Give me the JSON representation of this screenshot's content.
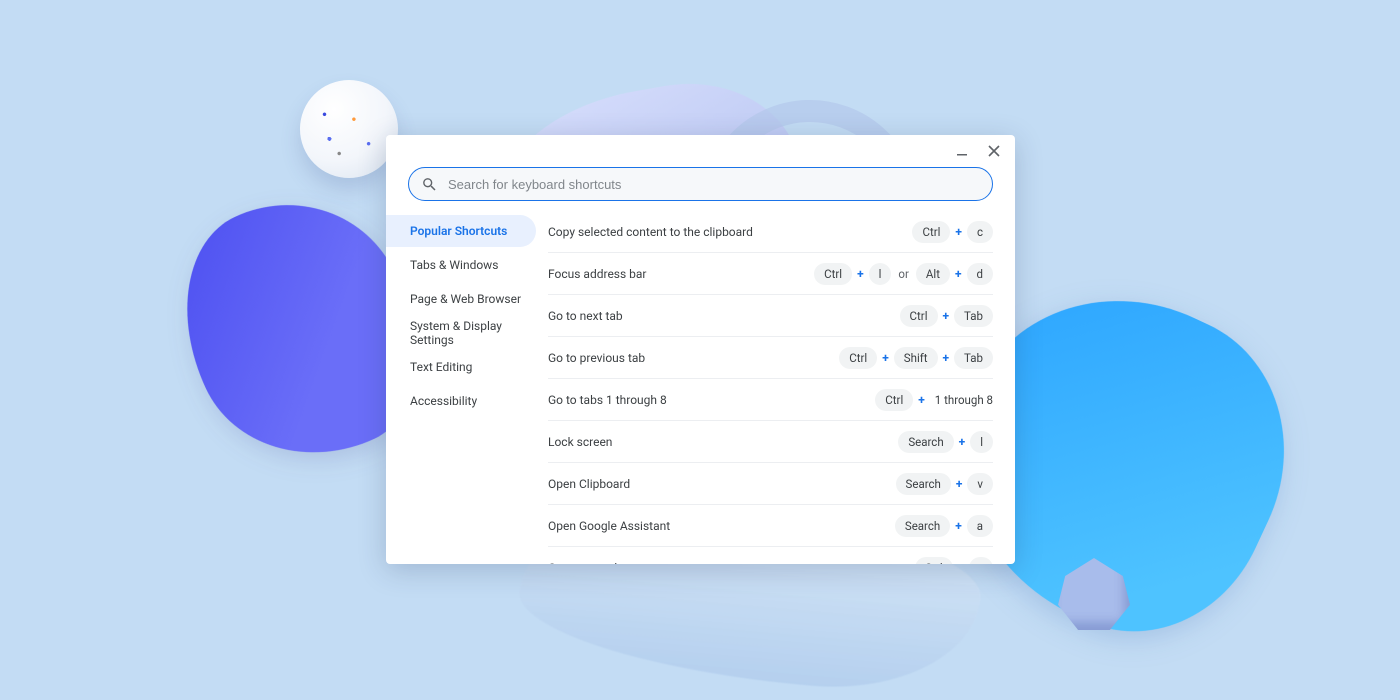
{
  "search": {
    "placeholder": "Search for keyboard shortcuts"
  },
  "sidebar": {
    "items": [
      {
        "label": "Popular Shortcuts",
        "active": true
      },
      {
        "label": "Tabs & Windows"
      },
      {
        "label": "Page & Web Browser"
      },
      {
        "label": "System & Display Settings"
      },
      {
        "label": "Text Editing"
      },
      {
        "label": "Accessibility"
      }
    ]
  },
  "shortcuts": [
    {
      "label": "Copy selected content to the clipboard",
      "combos": [
        [
          "Ctrl",
          "c"
        ]
      ]
    },
    {
      "label": "Focus address bar",
      "combos": [
        [
          "Ctrl",
          "l"
        ],
        [
          "Alt",
          "d"
        ]
      ]
    },
    {
      "label": "Go to next tab",
      "combos": [
        [
          "Ctrl",
          "Tab"
        ]
      ]
    },
    {
      "label": "Go to previous tab",
      "combos": [
        [
          "Ctrl",
          "Shift",
          "Tab"
        ]
      ]
    },
    {
      "label": "Go to tabs 1 through 8",
      "combos": [
        [
          "Ctrl"
        ]
      ],
      "suffix": "1 through 8"
    },
    {
      "label": "Lock screen",
      "combos": [
        [
          "Search",
          "l"
        ]
      ]
    },
    {
      "label": "Open Clipboard",
      "combos": [
        [
          "Search",
          "v"
        ]
      ]
    },
    {
      "label": "Open Google Assistant",
      "combos": [
        [
          "Search",
          "a"
        ]
      ]
    },
    {
      "label": "Open new tab",
      "combos": [
        [
          "Ctrl",
          "t"
        ]
      ]
    }
  ],
  "separators": {
    "plus": "+",
    "or": "or"
  }
}
